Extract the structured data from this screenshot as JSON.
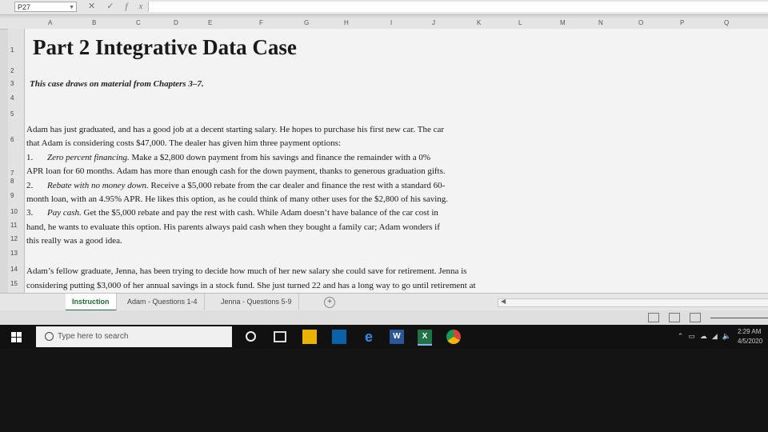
{
  "formula_bar": {
    "name_box": "P27",
    "icons": [
      "close-icon",
      "check-icon",
      "function-icon"
    ]
  },
  "columns": [
    "A",
    "B",
    "C",
    "D",
    "E",
    "F",
    "G",
    "H",
    "I",
    "J",
    "K",
    "L",
    "M",
    "N",
    "O",
    "P",
    "Q"
  ],
  "rows": [
    "1",
    "2",
    "3",
    "4",
    "5",
    "6",
    "7",
    "8",
    "9",
    "10",
    "11",
    "12",
    "13",
    "14",
    "15"
  ],
  "sheet": {
    "title": "Part 2 Integrative Data Case",
    "subtitle": "This case draws on material from Chapters 3–7.",
    "paragraph1": [
      "Adam has just graduated, and has a good job at a decent starting salary. He hopes to purchase his first new car. The car",
      "that Adam is considering costs $47,000. The dealer has given him three payment options:"
    ],
    "options": [
      {
        "num": "1.",
        "title": "Zero percent financing.",
        "text": " Make a $2,800 down payment from his savings and finance the remainder with a 0%"
      },
      {
        "num": "",
        "title": "",
        "text": "APR loan for 60 months. Adam has more than enough cash for the down payment, thanks to generous graduation gifts."
      },
      {
        "num": "2.",
        "title": "Rebate with no money down.",
        "text": " Receive a $5,000 rebate from the car dealer and finance the rest with a standard 60-"
      },
      {
        "num": "",
        "title": "",
        "text": "month loan, with an 4.95% APR. He likes this option, as he could think of many other uses for the $2,800 of his saving."
      },
      {
        "num": "3.",
        "title": "Pay cash.",
        "text": " Get the $5,000 rebate and pay the rest with cash. While Adam doesn’t have balance of the car cost in"
      },
      {
        "num": "",
        "title": "",
        "text": "hand, he wants to evaluate this option. His parents always paid cash when they bought a family car; Adam wonders if"
      },
      {
        "num": "",
        "title": "",
        "text": "this really was a good idea."
      }
    ],
    "paragraph2": [
      "Adam’s fellow graduate, Jenna, has been trying to decide how much of her new salary she could save for retirement. Jenna is",
      "considering putting $3,000 of her annual savings in a stock fund. She just turned 22 and has a long way to go until retirement at"
    ]
  },
  "tabs": [
    {
      "label": "Instruction",
      "active": true
    },
    {
      "label": "Adam - Questions 1-4",
      "active": false
    },
    {
      "label": "Jenna - Questions 5-9",
      "active": false
    }
  ],
  "taskbar": {
    "search_placeholder": "Type here to search",
    "apps": [
      "task-view-icon",
      "file-explorer-icon",
      "store-icon",
      "edge-icon",
      "word-icon",
      "excel-icon",
      "chrome-icon"
    ],
    "clock_time": "2:29 AM",
    "clock_date": "4/5/2020"
  }
}
